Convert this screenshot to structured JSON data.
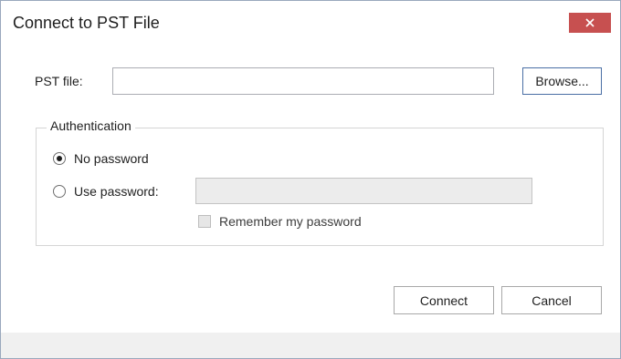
{
  "dialog": {
    "title": "Connect to PST File",
    "close_icon": "close-icon",
    "close_color": "#c75050"
  },
  "pst_file": {
    "label": "PST file:",
    "value": "",
    "browse_label": "Browse..."
  },
  "authentication": {
    "legend": "Authentication",
    "options": [
      {
        "label": "No password",
        "selected": true
      },
      {
        "label": "Use password:",
        "selected": false
      }
    ],
    "password_value": "",
    "password_enabled": false,
    "remember_label": "Remember my password",
    "remember_checked": false,
    "remember_enabled": false
  },
  "actions": {
    "connect_label": "Connect",
    "cancel_label": "Cancel"
  }
}
